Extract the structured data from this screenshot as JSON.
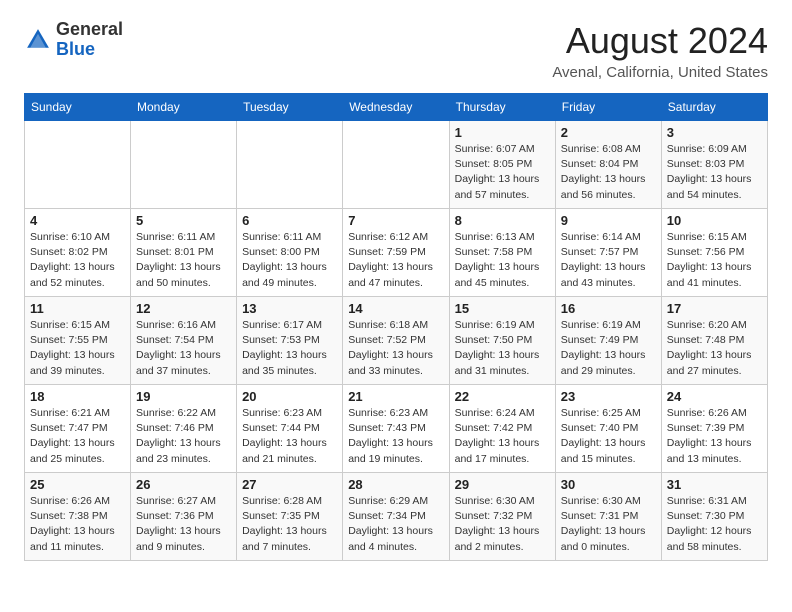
{
  "header": {
    "logo_general": "General",
    "logo_blue": "Blue",
    "month_year": "August 2024",
    "location": "Avenal, California, United States"
  },
  "days_of_week": [
    "Sunday",
    "Monday",
    "Tuesday",
    "Wednesday",
    "Thursday",
    "Friday",
    "Saturday"
  ],
  "weeks": [
    [
      {
        "day": "",
        "sunrise": "",
        "sunset": "",
        "daylight": ""
      },
      {
        "day": "",
        "sunrise": "",
        "sunset": "",
        "daylight": ""
      },
      {
        "day": "",
        "sunrise": "",
        "sunset": "",
        "daylight": ""
      },
      {
        "day": "",
        "sunrise": "",
        "sunset": "",
        "daylight": ""
      },
      {
        "day": "1",
        "sunrise": "Sunrise: 6:07 AM",
        "sunset": "Sunset: 8:05 PM",
        "daylight": "Daylight: 13 hours and 57 minutes."
      },
      {
        "day": "2",
        "sunrise": "Sunrise: 6:08 AM",
        "sunset": "Sunset: 8:04 PM",
        "daylight": "Daylight: 13 hours and 56 minutes."
      },
      {
        "day": "3",
        "sunrise": "Sunrise: 6:09 AM",
        "sunset": "Sunset: 8:03 PM",
        "daylight": "Daylight: 13 hours and 54 minutes."
      }
    ],
    [
      {
        "day": "4",
        "sunrise": "Sunrise: 6:10 AM",
        "sunset": "Sunset: 8:02 PM",
        "daylight": "Daylight: 13 hours and 52 minutes."
      },
      {
        "day": "5",
        "sunrise": "Sunrise: 6:11 AM",
        "sunset": "Sunset: 8:01 PM",
        "daylight": "Daylight: 13 hours and 50 minutes."
      },
      {
        "day": "6",
        "sunrise": "Sunrise: 6:11 AM",
        "sunset": "Sunset: 8:00 PM",
        "daylight": "Daylight: 13 hours and 49 minutes."
      },
      {
        "day": "7",
        "sunrise": "Sunrise: 6:12 AM",
        "sunset": "Sunset: 7:59 PM",
        "daylight": "Daylight: 13 hours and 47 minutes."
      },
      {
        "day": "8",
        "sunrise": "Sunrise: 6:13 AM",
        "sunset": "Sunset: 7:58 PM",
        "daylight": "Daylight: 13 hours and 45 minutes."
      },
      {
        "day": "9",
        "sunrise": "Sunrise: 6:14 AM",
        "sunset": "Sunset: 7:57 PM",
        "daylight": "Daylight: 13 hours and 43 minutes."
      },
      {
        "day": "10",
        "sunrise": "Sunrise: 6:15 AM",
        "sunset": "Sunset: 7:56 PM",
        "daylight": "Daylight: 13 hours and 41 minutes."
      }
    ],
    [
      {
        "day": "11",
        "sunrise": "Sunrise: 6:15 AM",
        "sunset": "Sunset: 7:55 PM",
        "daylight": "Daylight: 13 hours and 39 minutes."
      },
      {
        "day": "12",
        "sunrise": "Sunrise: 6:16 AM",
        "sunset": "Sunset: 7:54 PM",
        "daylight": "Daylight: 13 hours and 37 minutes."
      },
      {
        "day": "13",
        "sunrise": "Sunrise: 6:17 AM",
        "sunset": "Sunset: 7:53 PM",
        "daylight": "Daylight: 13 hours and 35 minutes."
      },
      {
        "day": "14",
        "sunrise": "Sunrise: 6:18 AM",
        "sunset": "Sunset: 7:52 PM",
        "daylight": "Daylight: 13 hours and 33 minutes."
      },
      {
        "day": "15",
        "sunrise": "Sunrise: 6:19 AM",
        "sunset": "Sunset: 7:50 PM",
        "daylight": "Daylight: 13 hours and 31 minutes."
      },
      {
        "day": "16",
        "sunrise": "Sunrise: 6:19 AM",
        "sunset": "Sunset: 7:49 PM",
        "daylight": "Daylight: 13 hours and 29 minutes."
      },
      {
        "day": "17",
        "sunrise": "Sunrise: 6:20 AM",
        "sunset": "Sunset: 7:48 PM",
        "daylight": "Daylight: 13 hours and 27 minutes."
      }
    ],
    [
      {
        "day": "18",
        "sunrise": "Sunrise: 6:21 AM",
        "sunset": "Sunset: 7:47 PM",
        "daylight": "Daylight: 13 hours and 25 minutes."
      },
      {
        "day": "19",
        "sunrise": "Sunrise: 6:22 AM",
        "sunset": "Sunset: 7:46 PM",
        "daylight": "Daylight: 13 hours and 23 minutes."
      },
      {
        "day": "20",
        "sunrise": "Sunrise: 6:23 AM",
        "sunset": "Sunset: 7:44 PM",
        "daylight": "Daylight: 13 hours and 21 minutes."
      },
      {
        "day": "21",
        "sunrise": "Sunrise: 6:23 AM",
        "sunset": "Sunset: 7:43 PM",
        "daylight": "Daylight: 13 hours and 19 minutes."
      },
      {
        "day": "22",
        "sunrise": "Sunrise: 6:24 AM",
        "sunset": "Sunset: 7:42 PM",
        "daylight": "Daylight: 13 hours and 17 minutes."
      },
      {
        "day": "23",
        "sunrise": "Sunrise: 6:25 AM",
        "sunset": "Sunset: 7:40 PM",
        "daylight": "Daylight: 13 hours and 15 minutes."
      },
      {
        "day": "24",
        "sunrise": "Sunrise: 6:26 AM",
        "sunset": "Sunset: 7:39 PM",
        "daylight": "Daylight: 13 hours and 13 minutes."
      }
    ],
    [
      {
        "day": "25",
        "sunrise": "Sunrise: 6:26 AM",
        "sunset": "Sunset: 7:38 PM",
        "daylight": "Daylight: 13 hours and 11 minutes."
      },
      {
        "day": "26",
        "sunrise": "Sunrise: 6:27 AM",
        "sunset": "Sunset: 7:36 PM",
        "daylight": "Daylight: 13 hours and 9 minutes."
      },
      {
        "day": "27",
        "sunrise": "Sunrise: 6:28 AM",
        "sunset": "Sunset: 7:35 PM",
        "daylight": "Daylight: 13 hours and 7 minutes."
      },
      {
        "day": "28",
        "sunrise": "Sunrise: 6:29 AM",
        "sunset": "Sunset: 7:34 PM",
        "daylight": "Daylight: 13 hours and 4 minutes."
      },
      {
        "day": "29",
        "sunrise": "Sunrise: 6:30 AM",
        "sunset": "Sunset: 7:32 PM",
        "daylight": "Daylight: 13 hours and 2 minutes."
      },
      {
        "day": "30",
        "sunrise": "Sunrise: 6:30 AM",
        "sunset": "Sunset: 7:31 PM",
        "daylight": "Daylight: 13 hours and 0 minutes."
      },
      {
        "day": "31",
        "sunrise": "Sunrise: 6:31 AM",
        "sunset": "Sunset: 7:30 PM",
        "daylight": "Daylight: 12 hours and 58 minutes."
      }
    ]
  ]
}
